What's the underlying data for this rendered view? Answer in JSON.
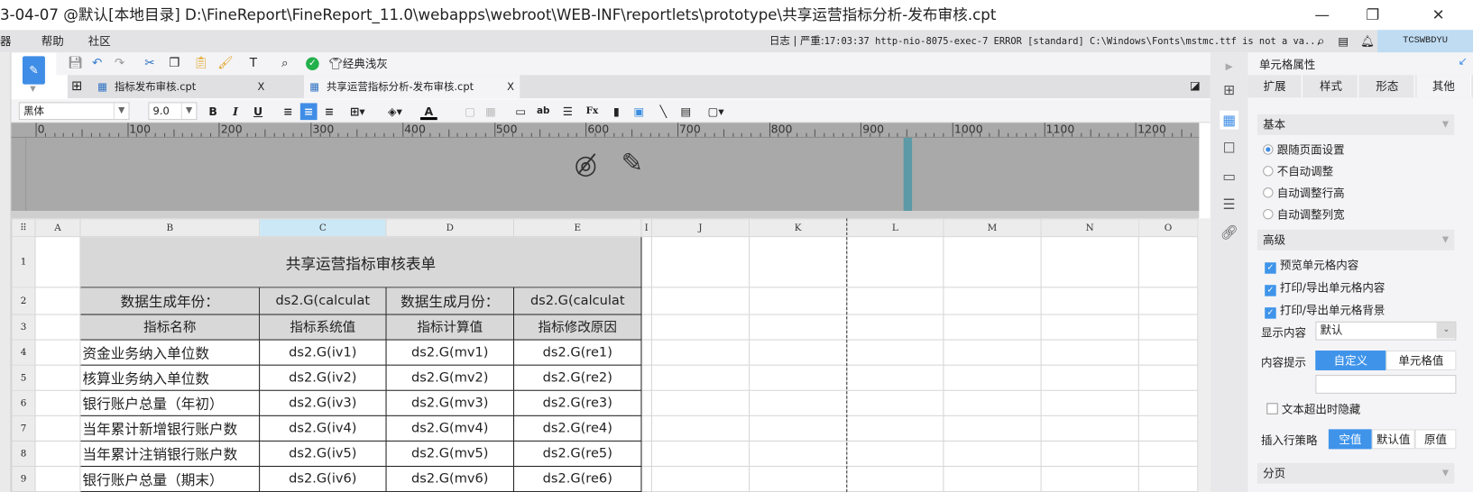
{
  "window": {
    "title": "3-04-07 @默认[本地目录]     D:\\FineReport\\FineReport_11.0\\webapps\\webroot\\WEB-INF\\reportlets\\prototype\\共享运营指标分析-发布审核.cpt",
    "minimize": "—",
    "maximize": "❐",
    "close": "✕"
  },
  "menu": {
    "items": [
      "器",
      "帮助",
      "社区"
    ],
    "log_label": "日志 | 严重:",
    "log_text": "17:03:37 http-nio-8075-exec-7 ERROR [standard] C:\\Windows\\Fonts\\mstmc.ttf is not a va...",
    "user": "TCSWBDYU"
  },
  "toolbar": {
    "theme_label": "经典浅灰"
  },
  "tabs": [
    {
      "label": "指标发布审核.cpt",
      "close": "X"
    },
    {
      "label": "共享运营指标分析-发布审核.cpt",
      "close": "X"
    }
  ],
  "format": {
    "font": "黑体",
    "size": "9.0",
    "bold": "B",
    "italic": "I",
    "underline": "U"
  },
  "ruler": {
    "labels": [
      "0",
      "100",
      "200",
      "300",
      "400",
      "500",
      "600",
      "700",
      "800",
      "900",
      "1000",
      "1100",
      "1200"
    ]
  },
  "grid": {
    "columns": [
      "A",
      "B",
      "C",
      "D",
      "E",
      "I",
      "J",
      "K",
      "L",
      "M",
      "N",
      "O"
    ],
    "selected_column": "C",
    "row_numbers": [
      "1",
      "2",
      "3",
      "4",
      "5",
      "6",
      "7",
      "8",
      "9"
    ],
    "title": "共享运营指标审核表单",
    "row2": [
      "数据生成年份：",
      "ds2.G(calculat",
      "数据生成月份：",
      "ds2.G(calculat"
    ],
    "headers": [
      "指标名称",
      "指标系统值",
      "指标计算值",
      "指标修改原因"
    ],
    "rows": [
      [
        "资金业务纳入单位数",
        "ds2.G(iv1)",
        "ds2.G(mv1)",
        "ds2.G(re1)"
      ],
      [
        "核算业务纳入单位数",
        "ds2.G(iv2)",
        "ds2.G(mv2)",
        "ds2.G(re2)"
      ],
      [
        "银行账户总量（年初）",
        "ds2.G(iv3)",
        "ds2.G(mv3)",
        "ds2.G(re3)"
      ],
      [
        "当年累计新增银行账户数",
        "ds2.G(iv4)",
        "ds2.G(mv4)",
        "ds2.G(re4)"
      ],
      [
        "当年累计注销银行账户数",
        "ds2.G(iv5)",
        "ds2.G(mv5)",
        "ds2.G(re5)"
      ],
      [
        "银行账户总量（期末）",
        "ds2.G(iv6)",
        "ds2.G(mv6)",
        "ds2.G(re6)"
      ]
    ]
  },
  "panel": {
    "title": "单元格属性",
    "tabs": [
      "扩展",
      "样式",
      "形态",
      "其他"
    ],
    "active_tab": "其他",
    "basic": {
      "label": "基本",
      "options": [
        "跟随页面设置",
        "不自动调整",
        "自动调整行高",
        "自动调整列宽"
      ],
      "selected": 0
    },
    "advanced": {
      "label": "高级",
      "checks": [
        "预览单元格内容",
        "打印/导出单元格内容",
        "打印/导出单元格背景"
      ],
      "display_label": "显示内容",
      "display_value": "默认",
      "tip_label": "内容提示",
      "tip_options": [
        "自定义",
        "单元格值"
      ],
      "tip_value": "",
      "hide_overflow": "文本超出时隐藏",
      "insert_label": "插入行策略",
      "insert_options": [
        "空值",
        "默认值",
        "原值"
      ]
    },
    "paging": {
      "label": "分页"
    }
  },
  "colors": {
    "accent": "#3f94ea",
    "selected_header": "#cce8f6",
    "teal_marker": "#5b9aa6"
  }
}
